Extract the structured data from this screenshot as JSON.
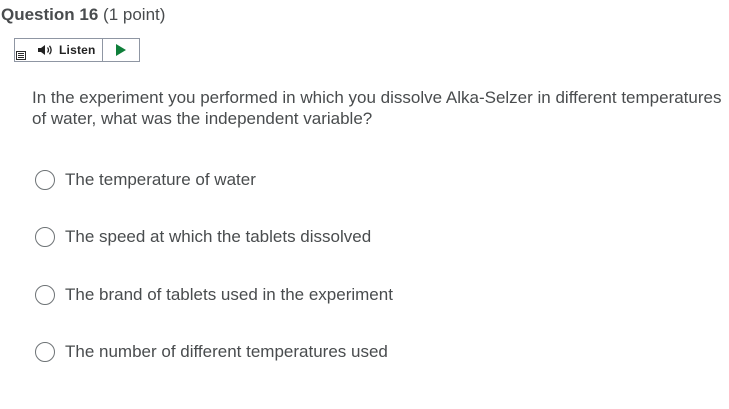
{
  "question": {
    "title": "Question 16",
    "points": "(1 point)",
    "text": "In the experiment you performed in which you dissolve Alka-Selzer in different temperatures of water, what was the independent variable?"
  },
  "listen": {
    "label": "Listen",
    "menu_icon": "menu-icon",
    "speaker_icon": "speaker-icon",
    "play_icon": "play-icon",
    "play_color": "#0f7f3a"
  },
  "options": [
    {
      "label": "The temperature of water",
      "selected": false
    },
    {
      "label": "The speed at which the tablets dissolved",
      "selected": false
    },
    {
      "label": "The brand of tablets used in the experiment",
      "selected": false
    },
    {
      "label": "The number of different temperatures used",
      "selected": false
    }
  ],
  "colors": {
    "text": "#494c4e",
    "border": "#8f96a3"
  }
}
